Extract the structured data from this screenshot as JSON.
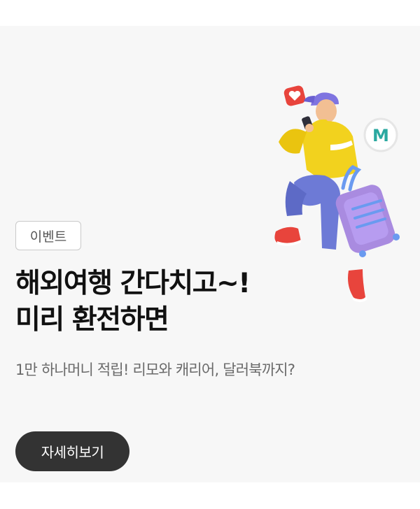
{
  "banner": {
    "badge": "이벤트",
    "headline": [
      "해외여행 간다치고~!",
      "미리 환전하면"
    ],
    "subtitle": "1만 하나머니 적립! 리모와 캐리어, 달러북까지?",
    "cta_label": "자세히보기",
    "logo_letter": "M",
    "illustration": {
      "icons": [
        "heart-icon",
        "traveler-figure",
        "suitcase-icon",
        "m-logo-icon"
      ]
    },
    "colors": {
      "background": "#f7f7f7",
      "cta": "#333333",
      "heart_badge": "#e8443c",
      "jacket": "#f2d21e",
      "suitcase": "#a98be0"
    }
  }
}
